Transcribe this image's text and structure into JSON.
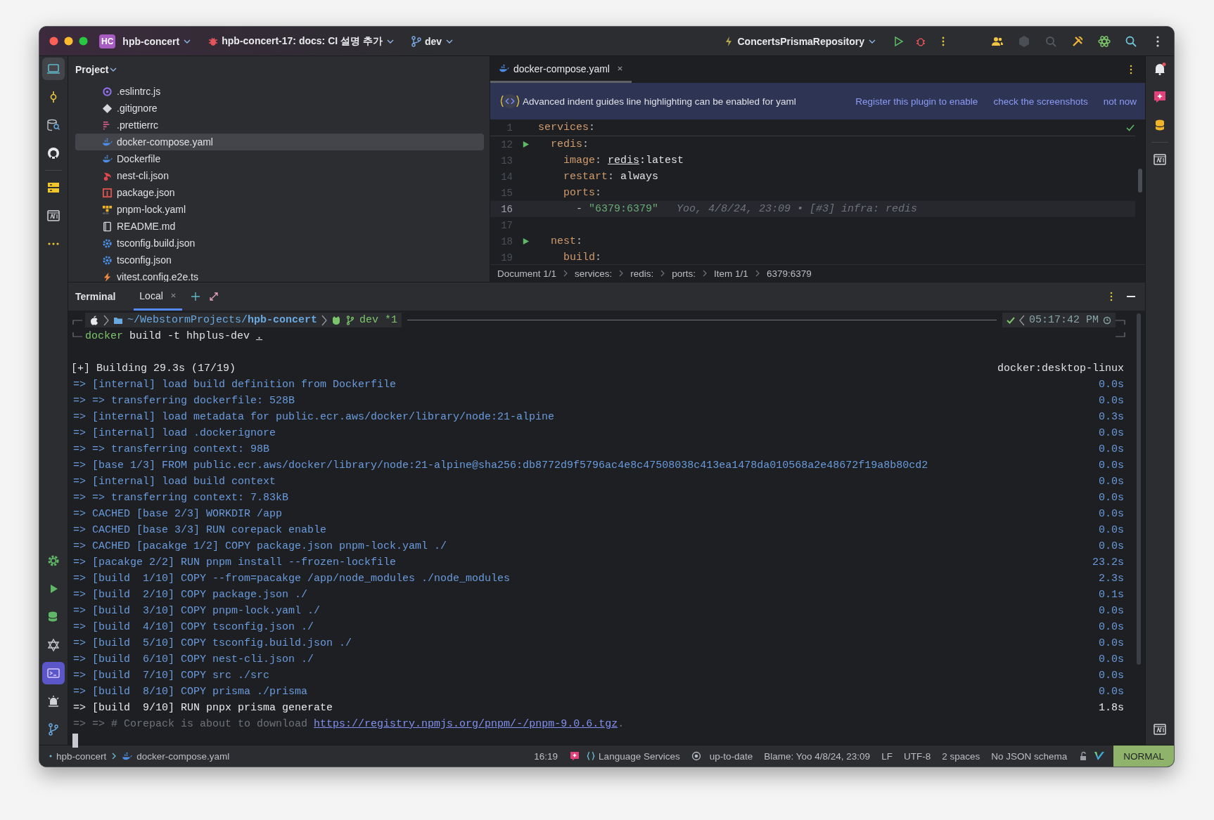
{
  "title_bar": {
    "project": {
      "badge": "HC",
      "name": "hpb-concert"
    },
    "task": "hpb-concert-17: docs: CI 설명 추가",
    "branch": "dev",
    "run_config": "ConcertsPrismaRepository"
  },
  "project_panel": {
    "title": "Project",
    "files": [
      {
        "name": ".eslintrc.js",
        "kind": "eslint",
        "selected": false
      },
      {
        "name": ".gitignore",
        "kind": "git",
        "selected": false
      },
      {
        "name": ".prettierrc",
        "kind": "prettier",
        "selected": false
      },
      {
        "name": "docker-compose.yaml",
        "kind": "docker",
        "selected": true
      },
      {
        "name": "Dockerfile",
        "kind": "docker",
        "selected": false
      },
      {
        "name": "nest-cli.json",
        "kind": "nest",
        "selected": false
      },
      {
        "name": "package.json",
        "kind": "npm",
        "selected": false
      },
      {
        "name": "pnpm-lock.yaml",
        "kind": "pnpm",
        "selected": false
      },
      {
        "name": "README.md",
        "kind": "readme",
        "selected": false
      },
      {
        "name": "tsconfig.build.json",
        "kind": "tsconfig",
        "selected": false
      },
      {
        "name": "tsconfig.json",
        "kind": "tsconfig",
        "selected": false
      },
      {
        "name": "vitest.config.e2e.ts",
        "kind": "vitest",
        "selected": false
      }
    ]
  },
  "editor": {
    "tabs": [
      {
        "label": "docker-compose.yaml",
        "selected": true
      }
    ],
    "banner": {
      "text": "Advanced indent guides line highlighting can be enabled for yaml",
      "actions": [
        "Register this plugin to enable",
        "check the screenshots",
        "not now"
      ]
    },
    "sticky_line": {
      "num": "1",
      "tokens": [
        {
          "kind": "key",
          "text": "services"
        },
        {
          "kind": "punct",
          "text": ":"
        }
      ]
    },
    "lines": [
      {
        "num": "12",
        "kind": "runnable",
        "current": false,
        "tokens": [
          {
            "kind": "key",
            "text": "  redis"
          },
          {
            "kind": "punct",
            "text": ":"
          }
        ]
      },
      {
        "num": "13",
        "kind": "plain",
        "current": false,
        "tokens": [
          {
            "kind": "key",
            "text": "    image"
          },
          {
            "kind": "punct",
            "text": ": "
          },
          {
            "kind": "ref",
            "text": "redis"
          },
          {
            "kind": "value",
            "text": ":latest"
          }
        ]
      },
      {
        "num": "14",
        "kind": "plain",
        "current": false,
        "tokens": [
          {
            "kind": "key",
            "text": "    restart"
          },
          {
            "kind": "punct",
            "text": ": "
          },
          {
            "kind": "value",
            "text": "always"
          }
        ]
      },
      {
        "num": "15",
        "kind": "plain",
        "current": false,
        "tokens": [
          {
            "kind": "key",
            "text": "    ports"
          },
          {
            "kind": "punct",
            "text": ":"
          }
        ]
      },
      {
        "num": "16",
        "kind": "plain",
        "current": true,
        "tokens": [
          {
            "kind": "punct",
            "text": "      - "
          },
          {
            "kind": "string",
            "text": "\"6379:6379\""
          },
          {
            "kind": "blame",
            "text": "Yoo, 4/8/24, 23:09 • [#3] infra: redis"
          }
        ]
      },
      {
        "num": "17",
        "kind": "plain",
        "current": false
      },
      {
        "num": "18",
        "kind": "runnable",
        "current": false,
        "tokens": [
          {
            "kind": "key",
            "text": "  nest"
          },
          {
            "kind": "punct",
            "text": ":"
          }
        ]
      },
      {
        "num": "19",
        "kind": "plain",
        "current": false,
        "tokens": [
          {
            "kind": "key",
            "text": "    build"
          },
          {
            "kind": "punct",
            "text": ":"
          }
        ]
      }
    ],
    "breadcrumbs": [
      "Document 1/1",
      "services:",
      "redis:",
      "ports:",
      "Item 1/1",
      "6379:6379"
    ]
  },
  "terminal": {
    "title": "Terminal",
    "tabs": [
      {
        "label": "Local",
        "selected": true
      }
    ],
    "prompt": {
      "path_prefix": "~/WebstormProjects/",
      "path_dir": "hpb-concert",
      "branch": "dev *1",
      "time": "05:17:42 PM"
    },
    "command": {
      "program": "docker",
      "args": "build -t hhplus-dev",
      "target": "."
    },
    "output": [
      {
        "kind": "header",
        "text": "[+] Building 29.3s (17/19)",
        "right": "docker:desktop-linux"
      },
      {
        "kind": "done",
        "text": "=> [internal] load build definition from Dockerfile",
        "right": "0.0s"
      },
      {
        "kind": "done",
        "text": "=> => transferring dockerfile: 528B",
        "right": "0.0s"
      },
      {
        "kind": "done",
        "text": "=> [internal] load metadata for public.ecr.aws/docker/library/node:21-alpine",
        "right": "0.3s"
      },
      {
        "kind": "done",
        "text": "=> [internal] load .dockerignore",
        "right": "0.0s"
      },
      {
        "kind": "done",
        "text": "=> => transferring context: 98B",
        "right": "0.0s"
      },
      {
        "kind": "done",
        "text": "=> [base 1/3] FROM public.ecr.aws/docker/library/node:21-alpine@sha256:db8772d9f5796ac4e8c47508038c413ea1478da010568a2e48672f19a8b80cd2",
        "right": "0.0s"
      },
      {
        "kind": "done",
        "text": "=> [internal] load build context",
        "right": "0.0s"
      },
      {
        "kind": "done",
        "text": "=> => transferring context: 7.83kB",
        "right": "0.0s"
      },
      {
        "kind": "done",
        "text": "=> CACHED [base 2/3] WORKDIR /app",
        "right": "0.0s"
      },
      {
        "kind": "done",
        "text": "=> CACHED [base 3/3] RUN corepack enable",
        "right": "0.0s"
      },
      {
        "kind": "done",
        "text": "=> CACHED [pacakge 1/2] COPY package.json pnpm-lock.yaml ./",
        "right": "0.0s"
      },
      {
        "kind": "done",
        "text": "=> [pacakge 2/2] RUN pnpm install --frozen-lockfile",
        "right": "23.2s"
      },
      {
        "kind": "done",
        "text": "=> [build  1/10] COPY --from=pacakge /app/node_modules ./node_modules",
        "right": "2.3s"
      },
      {
        "kind": "done",
        "text": "=> [build  2/10] COPY package.json ./",
        "right": "0.1s"
      },
      {
        "kind": "done",
        "text": "=> [build  3/10] COPY pnpm-lock.yaml ./",
        "right": "0.0s"
      },
      {
        "kind": "done",
        "text": "=> [build  4/10] COPY tsconfig.json ./",
        "right": "0.0s"
      },
      {
        "kind": "done",
        "text": "=> [build  5/10] COPY tsconfig.build.json ./",
        "right": "0.0s"
      },
      {
        "kind": "done",
        "text": "=> [build  6/10] COPY nest-cli.json ./",
        "right": "0.0s"
      },
      {
        "kind": "done",
        "text": "=> [build  7/10] COPY src ./src",
        "right": "0.0s"
      },
      {
        "kind": "done",
        "text": "=> [build  8/10] COPY prisma ./prisma",
        "right": "0.0s"
      },
      {
        "kind": "active",
        "text": "=> [build  9/10] RUN pnpx prisma generate",
        "right": "1.8s"
      },
      {
        "kind": "log",
        "text": "=> => # Corepack is about to download",
        "link": "https://registry.npmjs.org/pnpm/-/pnpm-9.0.6.tgz",
        "tail": "."
      }
    ]
  },
  "status_bar": {
    "breadcrumbs": [
      "hpb-concert",
      "docker-compose.yaml"
    ],
    "position": "16:19",
    "language_services": "Language Services",
    "vcs": "up-to-date",
    "blame": "Blame: Yoo 4/8/24, 23:09",
    "line_ending": "LF",
    "encoding": "UTF-8",
    "indent": "2 spaces",
    "schema": "No JSON schema",
    "mode": "NORMAL"
  }
}
